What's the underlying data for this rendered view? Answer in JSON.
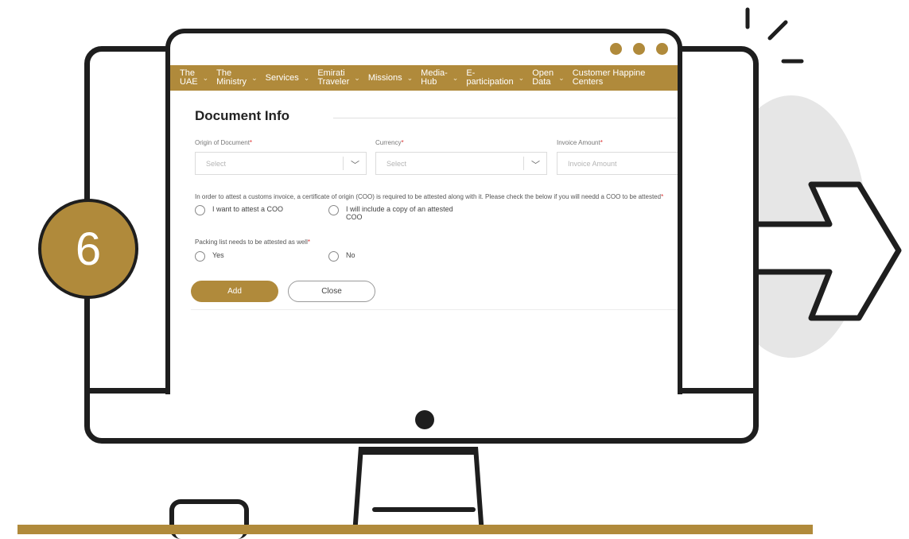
{
  "step": {
    "number": "6"
  },
  "colors": {
    "accent": "#b08a3b",
    "outline": "#1e1e1e"
  },
  "nav": {
    "items": [
      {
        "label": "The\nUAE",
        "chevron": "⌄"
      },
      {
        "label": "The\nMinistry",
        "chevron": "⌄"
      },
      {
        "label": "Services",
        "chevron": "⌄"
      },
      {
        "label": "Emirati\nTraveler",
        "chevron": "⌄"
      },
      {
        "label": "Missions",
        "chevron": "⌄"
      },
      {
        "label": "Media-\nHub",
        "chevron": "⌄"
      },
      {
        "label": "E-\nparticipation",
        "chevron": "⌄"
      },
      {
        "label": "Open\nData",
        "chevron": "⌄"
      },
      {
        "label": "Customer Happine\nCenters",
        "chevron": ""
      }
    ]
  },
  "form": {
    "title": "Document Info",
    "origin": {
      "label": "Origin of Document",
      "placeholder": "Select"
    },
    "currency": {
      "label": "Currency",
      "placeholder": "Select"
    },
    "invoice": {
      "label": "Invoice Amount",
      "placeholder": "Invoice Amount"
    },
    "required_mark": "*",
    "coo_note": "In order to attest a customs invoice, a certificate of origin (COO) is required to be attested along with it. Please check the below if you will needd a COO to be attested",
    "coo_options": [
      "I want to attest a COO",
      "I will include a copy of an attested COO"
    ],
    "packing_label": "Packing list needs to be attested as well",
    "packing_options": [
      "Yes",
      "No"
    ],
    "add_label": "Add",
    "close_label": "Close"
  }
}
